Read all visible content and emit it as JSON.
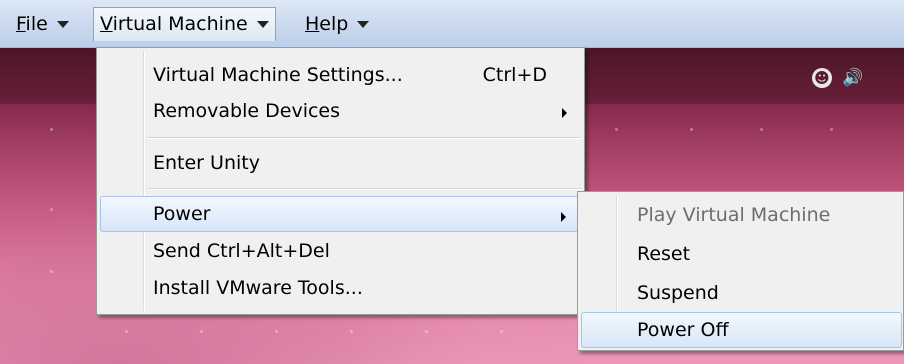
{
  "menubar": {
    "file": {
      "mnemonic": "F",
      "rest": "ile"
    },
    "virtual_machine": {
      "mnemonic": "V",
      "rest": "irtual Machine"
    },
    "help": {
      "mnemonic": "H",
      "rest": "elp"
    }
  },
  "vm_menu": {
    "items": [
      {
        "label": "Virtual Machine Settings...",
        "shortcut": "Ctrl+D"
      },
      {
        "label": "Removable Devices"
      },
      {
        "label": "Enter Unity"
      },
      {
        "label": "Power"
      },
      {
        "label": "Send Ctrl+Alt+Del"
      },
      {
        "label": "Install VMware Tools..."
      }
    ]
  },
  "power_menu": {
    "items": [
      {
        "label": "Play Virtual Machine",
        "enabled": false
      },
      {
        "label": "Reset",
        "enabled": true
      },
      {
        "label": "Suspend",
        "enabled": true
      },
      {
        "label": "Power Off",
        "enabled": true,
        "highlighted": true
      }
    ]
  },
  "tray": {
    "icons": [
      "accessibility-icon",
      "volume-icon"
    ]
  },
  "colors": {
    "menubar": "#cad9ee",
    "menu_bg": "#f0f0f0",
    "highlight": "#d6e6f8",
    "desktop": "#c45a82"
  }
}
